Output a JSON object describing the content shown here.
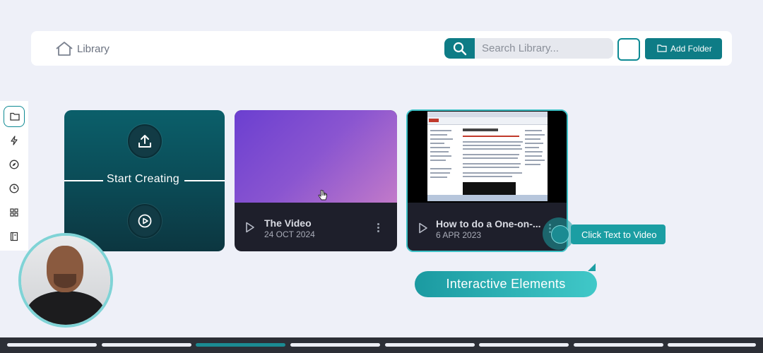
{
  "header": {
    "home_label": "Library",
    "search_placeholder": "Search Library...",
    "add_folder_label": "Add Folder"
  },
  "sidebar": {
    "items": [
      {
        "icon": "folder-icon",
        "active": true
      },
      {
        "icon": "lightning-icon"
      },
      {
        "icon": "compass-icon"
      },
      {
        "icon": "clock-icon"
      },
      {
        "icon": "grid-icon"
      },
      {
        "icon": "book-icon"
      }
    ]
  },
  "cards": {
    "create": {
      "label": "Start Creating",
      "upload_icon": "upload-icon",
      "record_icon": "record-icon"
    },
    "video1": {
      "title": "The Video",
      "date": "24 OCT 2024"
    },
    "video2": {
      "title": "How to do a One-on-...",
      "date": "6 APR 2023"
    }
  },
  "overlay": {
    "hotspot_label": "Click Text to Video",
    "feature_label": "Interactive Elements"
  },
  "progress": {
    "segments": 8,
    "active_index": 2
  },
  "colors": {
    "accent": "#0e7c86",
    "teal_light": "#40c8c8",
    "background": "#eef0f8",
    "card_dark": "#1e1f2b"
  }
}
